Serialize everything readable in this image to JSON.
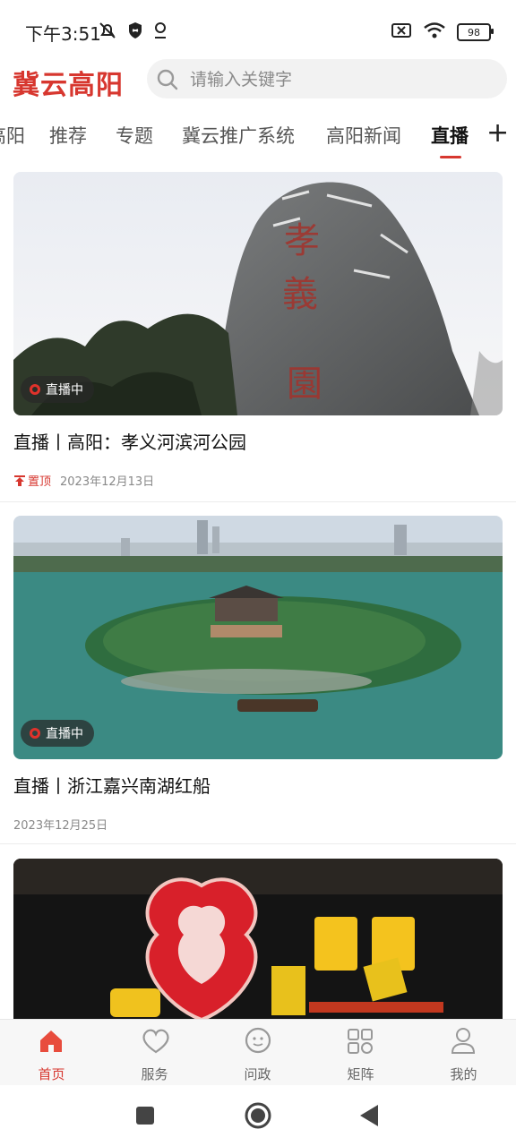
{
  "status_bar": {
    "time": "下午3:51",
    "battery": "98"
  },
  "header": {
    "logo": "冀云高阳",
    "search_placeholder": "请输入关键字"
  },
  "tabs": [
    "高阳",
    "推荐",
    "专题",
    "冀云推广系统",
    "高阳新闻",
    "直播"
  ],
  "active_tab": "直播",
  "feed": [
    {
      "badge": "直播中",
      "title": "直播丨高阳：孝义河滨河公园",
      "pinned_label": "置顶",
      "date": "2023年12月13日"
    },
    {
      "badge": "直播中",
      "title": "直播丨浙江嘉兴南湖红船",
      "date": "2023年12月25日"
    }
  ],
  "bottom_nav": [
    {
      "label": "首页",
      "icon": "home-icon",
      "active": true
    },
    {
      "label": "服务",
      "icon": "heart-icon",
      "active": false
    },
    {
      "label": "问政",
      "icon": "chat-icon",
      "active": false
    },
    {
      "label": "矩阵",
      "icon": "grid-icon",
      "active": false
    },
    {
      "label": "我的",
      "icon": "user-icon",
      "active": false
    }
  ],
  "colors": {
    "brand": "#d7372f",
    "text": "#111111",
    "muted": "#888888"
  }
}
